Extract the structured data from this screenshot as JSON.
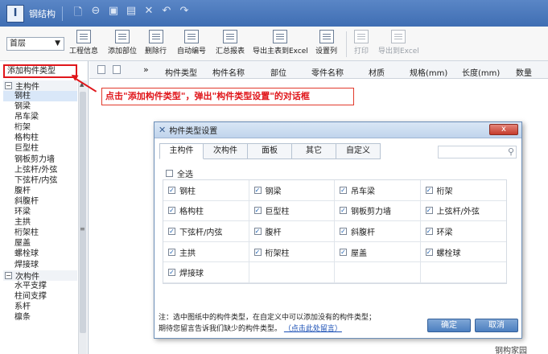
{
  "titlebar": {
    "logo": "I",
    "title": "钢结构",
    "icons": [
      "new-file-icon",
      "open-file-icon",
      "save-icon",
      "save-as-icon",
      "close-icon",
      "undo-icon",
      "redo-icon"
    ],
    "icon_glyphs": [
      "🗋",
      "⊖",
      "▣",
      "▤",
      "✕",
      "↶",
      "↷"
    ]
  },
  "toolbar": {
    "floor_select": "首层",
    "tools": [
      {
        "label": "工程信息"
      },
      {
        "label": "添加部位"
      },
      {
        "label": "删除行"
      },
      {
        "label": "自动编号"
      },
      {
        "label": "汇总报表"
      },
      {
        "label": "导出主表到Excel"
      },
      {
        "label": "设置列"
      },
      {
        "label": "打印"
      },
      {
        "label": "导出到Excel"
      }
    ]
  },
  "left_panel": {
    "add_type_button": "添加构件类型",
    "groups": [
      {
        "label": "主构件",
        "toggle": "−",
        "items": [
          "钢柱",
          "钢梁",
          "吊车梁",
          "桁架",
          "格构柱",
          "巨型柱",
          "钢板剪力墙",
          "上弦杆/外弦",
          "下弦杆/内弦",
          "腹杆",
          "斜腹杆",
          "环梁",
          "主拱",
          "桁架柱",
          "屋盖",
          "螺栓球",
          "焊接球"
        ]
      },
      {
        "label": "次构件",
        "toggle": "−",
        "items": [
          "水平支撑",
          "柱间支撑",
          "系杆",
          "檩条"
        ]
      }
    ],
    "scroll_grip": "≡"
  },
  "table": {
    "more": "»",
    "columns": [
      "构件类型",
      "构件名称",
      "部位",
      "零件名称",
      "材质",
      "规格(mm)",
      "长度(mm)",
      "数量"
    ]
  },
  "annotation": {
    "text": "点击\"添加构件类型\"，弹出\"构件类型设置\"的对话框"
  },
  "dialog": {
    "title": "构件类型设置",
    "close_label": "x",
    "tabs": [
      "主构件",
      "次构件",
      "面板",
      "其它",
      "自定义"
    ],
    "active_tab": 0,
    "select_all_label": "全选",
    "check_mark": "✓",
    "types": [
      {
        "label": "钢柱",
        "checked": true
      },
      {
        "label": "钢梁",
        "checked": true
      },
      {
        "label": "吊车梁",
        "checked": true
      },
      {
        "label": "桁架",
        "checked": true
      },
      {
        "label": "格构柱",
        "checked": true
      },
      {
        "label": "巨型柱",
        "checked": true
      },
      {
        "label": "钢板剪力墙",
        "checked": true
      },
      {
        "label": "上弦杆/外弦",
        "checked": true
      },
      {
        "label": "下弦杆/内弦",
        "checked": true
      },
      {
        "label": "腹杆",
        "checked": true
      },
      {
        "label": "斜腹杆",
        "checked": true
      },
      {
        "label": "环梁",
        "checked": true
      },
      {
        "label": "主拱",
        "checked": true
      },
      {
        "label": "桁架柱",
        "checked": true
      },
      {
        "label": "屋盖",
        "checked": true
      },
      {
        "label": "螺栓球",
        "checked": true
      },
      {
        "label": "焊接球",
        "checked": true
      }
    ],
    "note_line1": "注：选中图纸中的构件类型，在自定义中可以添加没有的构件类型；",
    "note_line2": "期待您留言告诉我们缺少的构件类型。",
    "note_link": "（点击此处留言）",
    "ok_label": "确定",
    "cancel_label": "取消"
  },
  "watermark": "钢构家园"
}
